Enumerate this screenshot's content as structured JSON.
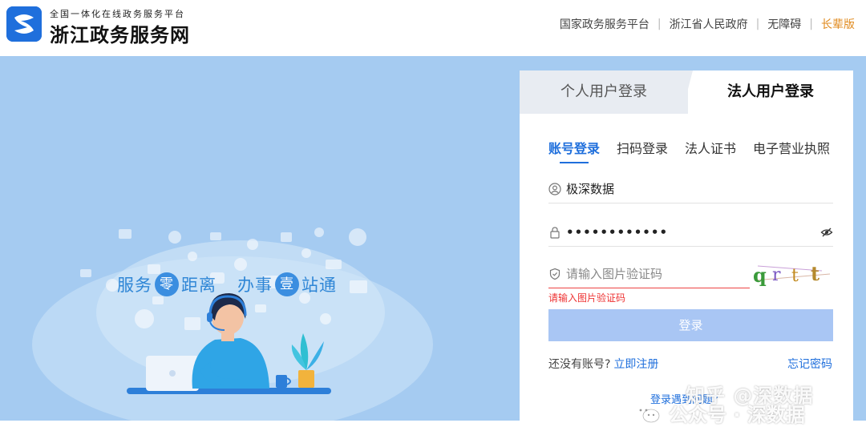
{
  "header": {
    "logo_subtitle": "全国一体化在线政务服务平台",
    "logo_title": "浙江政务服务网",
    "nav": [
      "国家政务服务平台",
      "浙江省人民政府",
      "无障碍",
      "长辈版"
    ]
  },
  "hero": {
    "slogan_part1": "服务",
    "slogan_circle1": "零",
    "slogan_part2": "距离",
    "slogan_part3": "办事",
    "slogan_circle2": "壹",
    "slogan_part4": "站通"
  },
  "login": {
    "tab_personal": "个人用户登录",
    "tab_corporate": "法人用户登录",
    "subtabs": [
      "账号登录",
      "扫码登录",
      "法人证书",
      "电子营业执照"
    ],
    "active_subtab": 0,
    "username_value": "极深数据",
    "password_value": "••••••••••••",
    "captcha_placeholder": "请输入图片验证码",
    "captcha_text": "qrtt",
    "captcha_error": "请输入图片验证码",
    "login_button": "登录",
    "no_account_text": "还没有账号?",
    "register_link": "立即注册",
    "forgot_link": "忘记密码",
    "problem_link": "登录遇到问题?"
  },
  "watermark": {
    "line1": "知乎 @深数据",
    "line2": "公众号 · 深数据"
  },
  "colors": {
    "brand_blue": "#1f6fdc",
    "hero_bg": "#a5cbf1",
    "elder_orange": "#e08a1e",
    "error_red": "#e33333",
    "button_disabled": "#a9c6f4"
  }
}
